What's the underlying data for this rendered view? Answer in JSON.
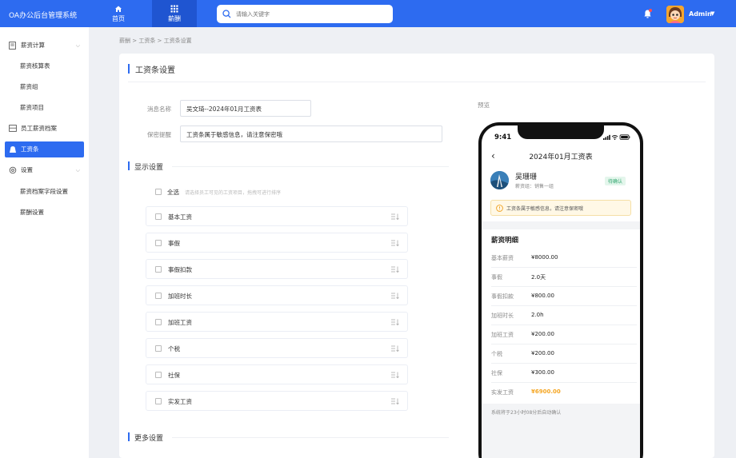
{
  "header": {
    "app_title": "OA办公后台管理系统",
    "nav": [
      {
        "label": "首页",
        "icon": "home-icon"
      },
      {
        "label": "薪酬",
        "icon": "grid-icon"
      }
    ],
    "search_placeholder": "请输入关键字",
    "user": "Admin"
  },
  "sidebar": {
    "items": [
      {
        "label": "薪资计算",
        "icon": "document-icon",
        "expandable": true
      },
      {
        "label": "薪资核算表"
      },
      {
        "label": "薪资组"
      },
      {
        "label": "薪资项目"
      },
      {
        "label": "员工薪资档案",
        "icon": "archive-icon"
      },
      {
        "label": "工资条",
        "icon": "payslip-icon",
        "active": true
      },
      {
        "label": "设置",
        "icon": "settings-icon",
        "expandable": true
      },
      {
        "label": "薪资档案字段设置"
      },
      {
        "label": "薪酬设置"
      }
    ]
  },
  "breadcrumb": "薪酬 > 工资条 > 工资条设置",
  "card": {
    "title": "工资条设置",
    "form": {
      "message_name_label": "消息名称",
      "message_name_value": "吴文琦--2024年01月工资表",
      "privacy_label": "保密提醒",
      "privacy_value": "工资条属于敏感信息，请注意保密哦"
    },
    "display_section": "显示设置",
    "select_all": "全选",
    "select_all_hint": "请选择员工可见的工资项目，拖拽可进行排序",
    "fields": [
      "基本工资",
      "事假",
      "事假扣款",
      "加班时长",
      "加班工资",
      "个税",
      "社保",
      "实发工资"
    ],
    "more_section": "更多设置",
    "preview_label": "预览"
  },
  "phone": {
    "time": "9:41",
    "title": "2024年01月工资表",
    "name": "吴珊珊",
    "dept": "薪资组：销售一组",
    "badge": "待确认",
    "notice": "工资条属于敏感信息，请注意保密哦",
    "section": "薪资明细",
    "rows": [
      {
        "k": "基本薪资",
        "v": "¥8000.00"
      },
      {
        "k": "事假",
        "v": "2.0天"
      },
      {
        "k": "事假扣款",
        "v": "¥800.00"
      },
      {
        "k": "加班时长",
        "v": "2.0h"
      },
      {
        "k": "加班工资",
        "v": "¥200.00"
      },
      {
        "k": "个税",
        "v": "¥200.00"
      },
      {
        "k": "社保",
        "v": "¥300.00"
      },
      {
        "k": "实发工资",
        "v": "¥6900.00",
        "highlight": true
      }
    ],
    "footer": "系统将于23小时08分后自动确认"
  },
  "colors": {
    "primary": "#2d6bf0",
    "highlight": "#f5a623",
    "success": "#2ea56d"
  }
}
